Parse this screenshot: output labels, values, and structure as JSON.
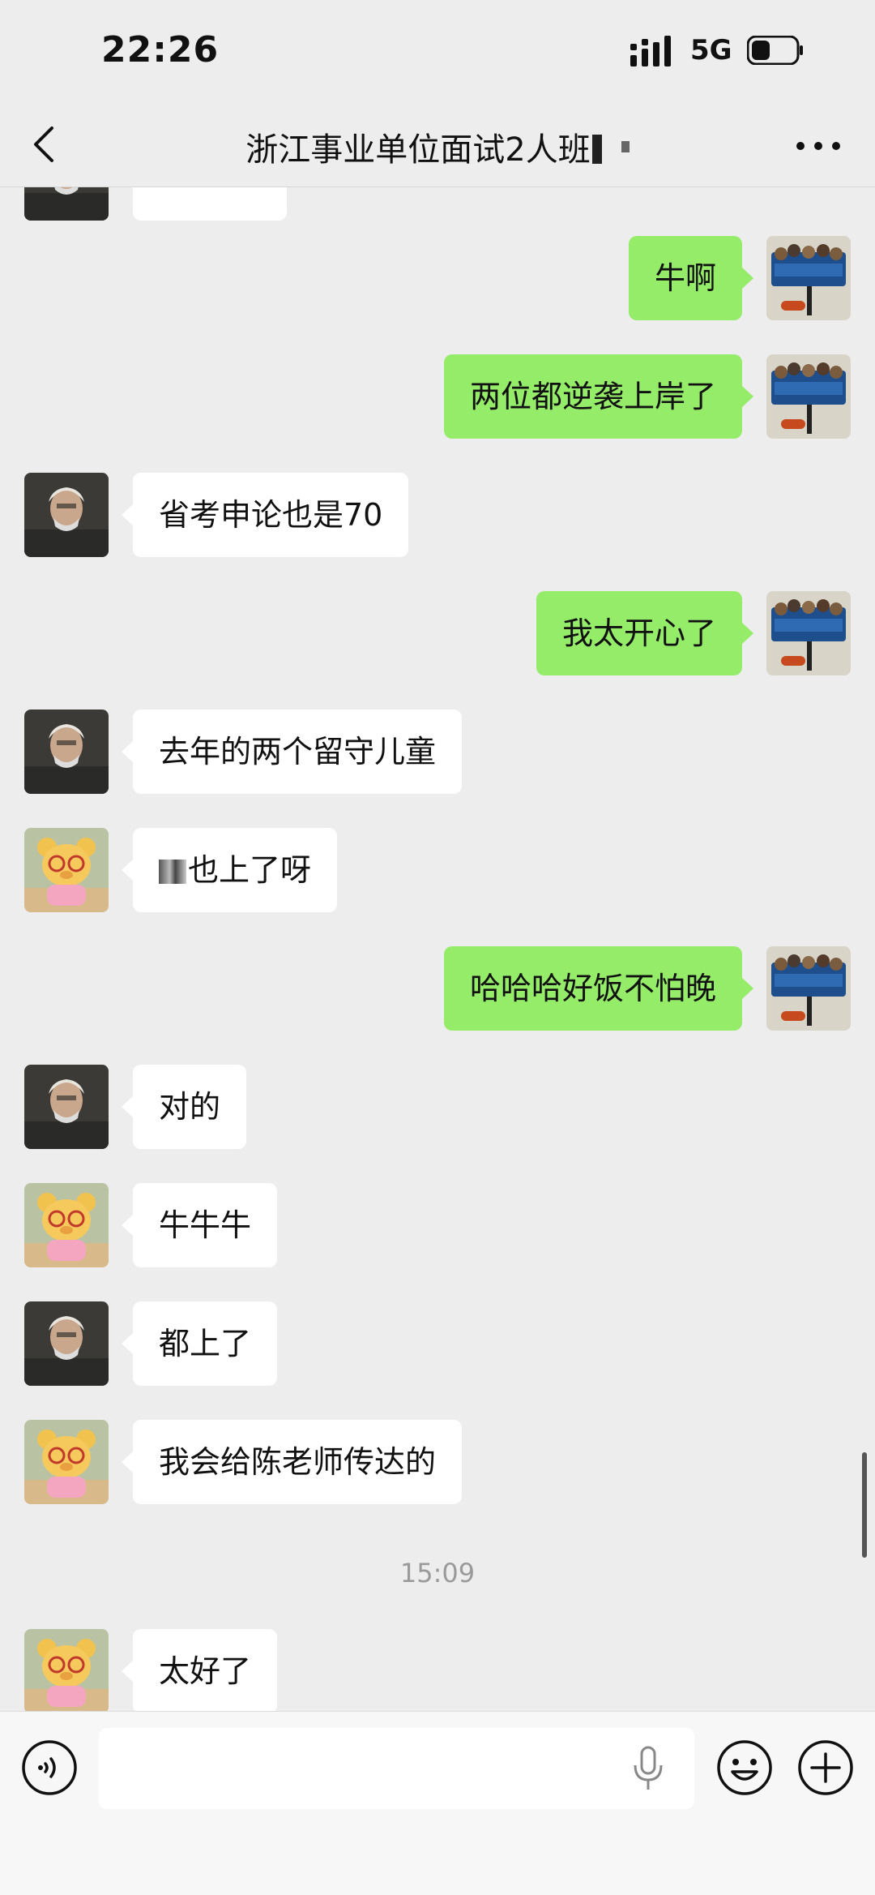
{
  "status_bar": {
    "time": "22:26",
    "network": "5G"
  },
  "nav": {
    "title": "浙江事业单位面试2人班"
  },
  "messages": [
    {
      "side": "right",
      "avatar": "group-banner",
      "text": "牛啊"
    },
    {
      "side": "right",
      "avatar": "group-banner",
      "text": "两位都逆袭上岸了"
    },
    {
      "side": "left",
      "avatar": "old-man",
      "text": "省考申论也是70"
    },
    {
      "side": "right",
      "avatar": "group-banner",
      "text": "我太开心了"
    },
    {
      "side": "left",
      "avatar": "old-man",
      "text": "去年的两个留守儿童"
    },
    {
      "side": "left",
      "avatar": "bear",
      "text": "也上了呀"
    },
    {
      "side": "right",
      "avatar": "group-banner",
      "text": "哈哈哈好饭不怕晚"
    },
    {
      "side": "left",
      "avatar": "old-man",
      "text": "对的"
    },
    {
      "side": "left",
      "avatar": "bear",
      "text": "牛牛牛"
    },
    {
      "side": "left",
      "avatar": "old-man",
      "text": "都上了"
    },
    {
      "side": "left",
      "avatar": "bear",
      "text": "我会给陈老师传达的"
    },
    {
      "side": "left",
      "avatar": "bear",
      "text": "太好了"
    }
  ],
  "timestamp": "15:09",
  "colors": {
    "background": "#ededed",
    "sent_bubble": "#95ec69",
    "received_bubble": "#ffffff"
  },
  "input_bar": {
    "icons": [
      "voice-icon",
      "mic-icon",
      "emoji-icon",
      "plus-icon"
    ]
  }
}
